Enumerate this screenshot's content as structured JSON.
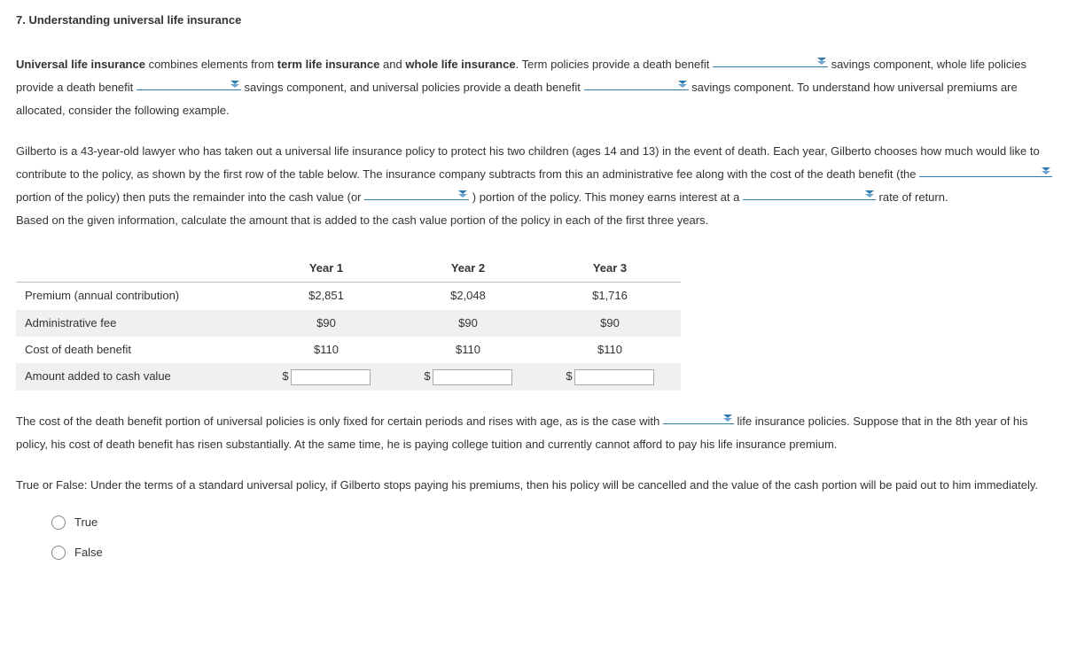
{
  "heading": "7. Understanding universal life insurance",
  "intro": {
    "t1": "Universal life insurance",
    "t2": " combines elements from ",
    "t3": "term life insurance",
    "t4": " and ",
    "t5": "whole life insurance",
    "t6": ". Term policies provide a death benefit ",
    "t7": " savings component, whole life policies provide a death benefit ",
    "t8": " savings component, and universal policies provide a death benefit ",
    "t9": " savings component. To understand how universal premiums are allocated, consider the following example."
  },
  "scenario": {
    "p1a": "Gilberto is a 43-year-old lawyer who has taken out a universal life insurance policy to protect his two children (ages 14 and 13) in the event of death. Each year, Gilberto chooses how much would like to contribute to the policy, as shown by the first row of the table below. The insurance company subtracts from this an administrative fee along with the cost of the death benefit (the ",
    "p1b": " portion of the policy) then puts the remainder into the cash value (or ",
    "p1c": " ) portion of the policy. This money earns interest at a ",
    "p1d": " rate of return.",
    "p2": "Based on the given information, calculate the amount that is added to the cash value portion of the policy in each of the first three years."
  },
  "table": {
    "headers": [
      "",
      "Year 1",
      "Year 2",
      "Year 3"
    ],
    "rows": [
      {
        "label": "Premium (annual contribution)",
        "cells": [
          "$2,851",
          "$2,048",
          "$1,716"
        ]
      },
      {
        "label": "Administrative fee",
        "cells": [
          "$90",
          "$90",
          "$90"
        ]
      },
      {
        "label": "Cost of death benefit",
        "cells": [
          "$110",
          "$110",
          "$110"
        ]
      },
      {
        "label": "Amount added to cash value",
        "cells": [
          "",
          "",
          ""
        ],
        "input": true
      }
    ],
    "prefix": "$"
  },
  "follow": {
    "t1": "The cost of the death benefit portion of universal policies is only fixed for certain periods and rises with age, as is the case with ",
    "t2": " life insurance policies. Suppose that in the 8th year of his policy, his cost of death benefit has risen substantially. At the same time, he is paying college tuition and currently cannot afford to pay his life insurance premium."
  },
  "tf": {
    "prompt": "True or False: Under the terms of a standard universal policy, if Gilberto stops paying his premiums, then his policy will be cancelled and the value of the cash portion will be paid out to him immediately.",
    "opt_true": "True",
    "opt_false": "False"
  }
}
